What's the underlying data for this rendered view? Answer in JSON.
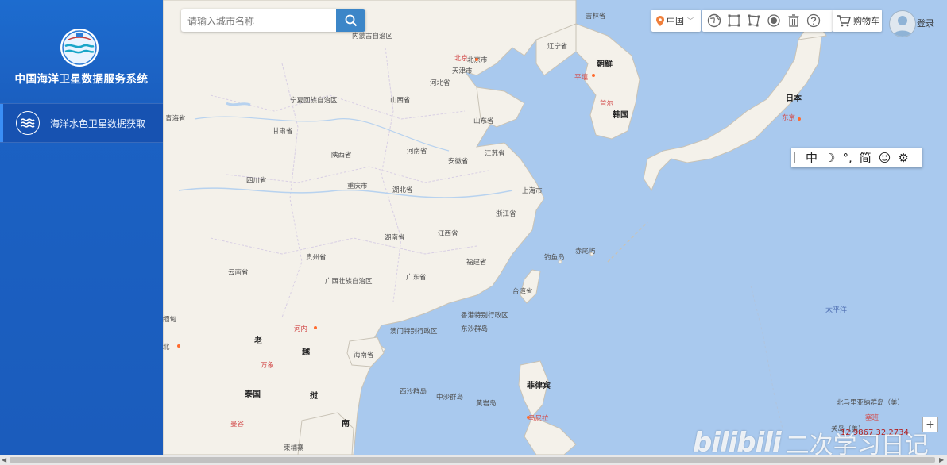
{
  "sidebar": {
    "title": "中国海洋卫星数据服务系统",
    "menu": [
      {
        "label": "海洋水色卫星数据获取",
        "icon": "wave-icon"
      }
    ]
  },
  "search": {
    "placeholder": "请输入城市名称",
    "button_icon": "search-icon"
  },
  "toolbar": {
    "region": "中国",
    "tools": [
      "globe-icon",
      "rectangle-select-icon",
      "polygon-select-icon",
      "point-select-icon",
      "trash-icon",
      "help-icon"
    ],
    "cart": "购物车",
    "login": "登录"
  },
  "ime": {
    "keys": [
      "中",
      "☽",
      "°,",
      "简",
      "☺",
      "⚙"
    ]
  },
  "map": {
    "labels": {
      "jilin": "吉林省",
      "nmg": "内蒙古自治区",
      "liaoning": "辽宁省",
      "beijing_cap": "北京",
      "beijing": "北京市",
      "tianjin": "天津市",
      "chaoxian": "朝鲜",
      "pingrang": "平壤",
      "hebei": "河北省",
      "ningxia": "宁夏回族自治区",
      "shanxi": "山西省",
      "qinghai": "青海省",
      "shandong": "山东省",
      "shouer": "首尔",
      "hanguo": "韩国",
      "riben": "日本",
      "dongjing": "东京",
      "gansu": "甘肃省",
      "henan": "河南省",
      "jiangsu": "江苏省",
      "shaanxi": "陕西省",
      "anhui": "安徽省",
      "sichuan": "四川省",
      "chongqing": "重庆市",
      "hubei": "湖北省",
      "shanghai": "上海市",
      "zhejiang": "浙江省",
      "hunan": "湖南省",
      "jiangxi": "江西省",
      "guizhou": "贵州省",
      "fujian": "福建省",
      "diaoyudao": "钓鱼岛",
      "chiweiyu": "赤尾屿",
      "yunnan": "云南省",
      "guangxi": "广西壮族自治区",
      "guangdong": "广东省",
      "taiwan": "台湾省",
      "taipingyang": "太平洋",
      "xianggang": "香港特别行政区",
      "aomen": "澳门特别行政区",
      "dongsha": "东沙群岛",
      "miandian": "缅甸",
      "henei": "河内",
      "lao": "老",
      "yue": "越",
      "wanxiang": "万象",
      "hainan": "海南省",
      "taiguo": "泰国",
      "xisha": "西沙群岛",
      "zhongsha": "中沙群岛",
      "huangyan": "黄岩岛",
      "feilvbin": "菲律宾",
      "mannila": "马尼拉",
      "wo": "挝",
      "nan": "南",
      "mangu": "曼谷",
      "jianpuzhai": "柬埔寨",
      "beimaliyana": "北马里亚纳群岛（美）",
      "saibanbao": "塞班",
      "guandao": "关岛（美）",
      "bei": "北"
    }
  },
  "coords": "12.9867  32.2734",
  "watermark": {
    "brand": "bilibili",
    "text": "二次学习日记"
  }
}
